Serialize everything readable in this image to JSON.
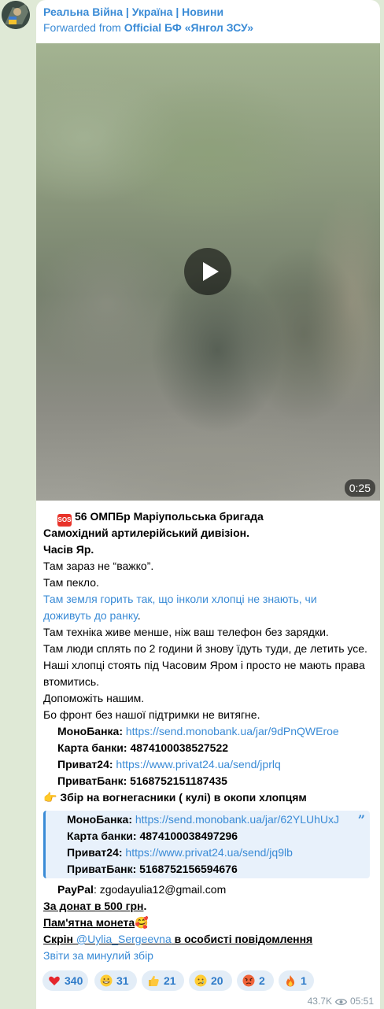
{
  "channel": {
    "name": "Реальна Війна | Україна | Новини",
    "forwarded_prefix": "Forwarded from ",
    "forwarded_from": "Official БФ «Янгол ЗСУ»"
  },
  "video": {
    "duration": "0:25"
  },
  "message": {
    "sos_label": "SOS",
    "line1": "56 ОМПБр Маріупольська бригада",
    "line2": "Самохідний артилерійський дивізіон.",
    "line3": "Часів Яр.",
    "line4": "Там зараз не “важко”.",
    "line5": "Там пекло.",
    "line6a": "Там земля горить так, що інколи хлопці не знають, чи",
    "line6b": "доживуть до ранку",
    "line6b_end": ".",
    "line7": "Там техніка живе менше, ніж ваш телефон без зарядки.",
    "line8": "Там люди сплять по 2 години й знову їдуть туди, де летить усе.",
    "line9a": "Наші хлопці стоять під Часовим Яром і просто не мають права",
    "line9b": "втомитись.",
    "line10": "Допоможіть нашим.",
    "line11": "Бо фронт без нашої підтримки не витягне.",
    "mono_label": "МоноБанка: ",
    "mono_link": "https://send.monobank.ua/jar/9dPnQWEroe",
    "card_label": "Карта банки: 4874100038527522",
    "privat24_label": "Приват24: ",
    "privat24_link": "https://www.privat24.ua/send/jprlq",
    "privatbank_label": "ПриватБанк: 5168752151187435",
    "pointing_emoji": "👉",
    "fire_ext": "Збір на вогнегасники ( кулі) в окопи хлопцям"
  },
  "quote": {
    "mono_label": "МоноБанка: ",
    "mono_link": "https://send.monobank.ua/jar/62YLUhUxJ",
    "card_label": "Карта банки: 4874100038497296",
    "privat24_label": "Приват24: ",
    "privat24_link": "https://www.privat24.ua/send/jq9lb",
    "privatbank_label": "ПриватБанк: 5168752156594676",
    "quote_icon": "”"
  },
  "tail": {
    "paypal_label": "PayPal",
    "paypal_value": ": zgodayulia12@gmail.com",
    "donate": "За донат в 500 грн",
    "donate_end": ".",
    "coin": "Пам'ятна монета",
    "coin_emoji": "🥰",
    "screen_prefix": "Скрін ",
    "screen_user": "@Uylia_Sergeevna",
    "screen_suffix": " в особисті повідомлення ",
    "report_link": "Звіти за минулий збір"
  },
  "reactions": [
    {
      "icon": "heart",
      "count": "340"
    },
    {
      "icon": "grin",
      "count": "31"
    },
    {
      "icon": "thumbs-up",
      "count": "21"
    },
    {
      "icon": "cry",
      "count": "20"
    },
    {
      "icon": "angry",
      "count": "2"
    },
    {
      "icon": "fire",
      "count": "1"
    }
  ],
  "footer": {
    "views": "43.7K",
    "time": "05:51"
  }
}
